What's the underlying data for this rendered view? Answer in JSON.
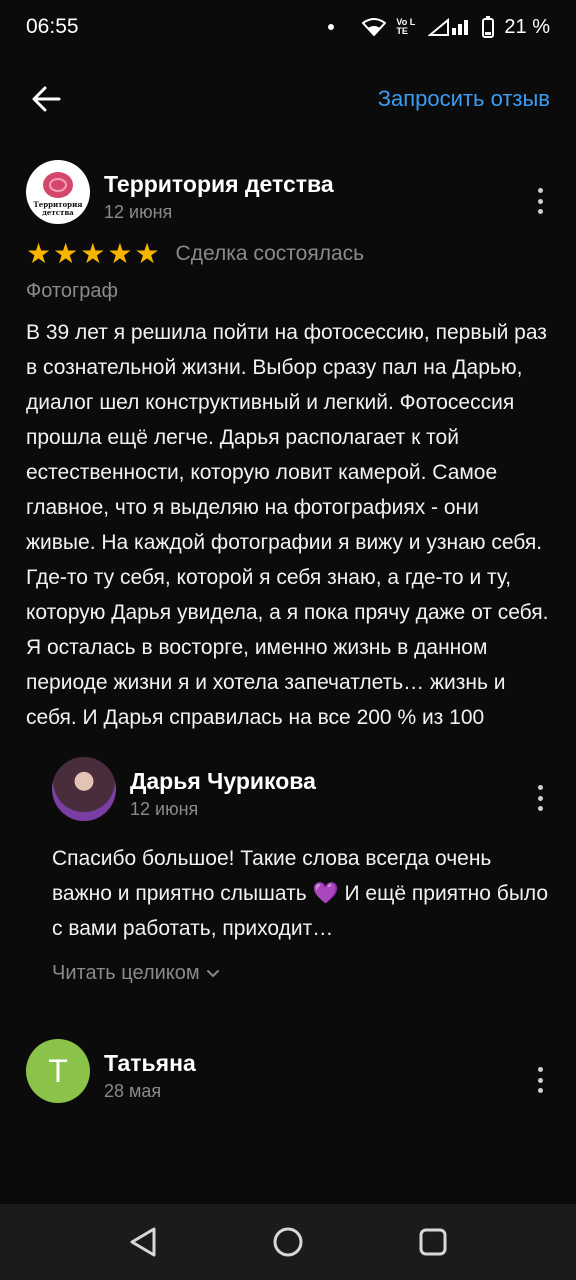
{
  "status_bar": {
    "time": "06:55",
    "network_label": "Vo LTE",
    "battery": "21 %"
  },
  "app_bar": {
    "back_icon": "arrow-left-icon",
    "request_label": "Запросить отзыв",
    "accent_color": "#3a9cf2"
  },
  "review": {
    "author": "Территория детства",
    "logo_text": "Территория детства",
    "date": "12 июня",
    "rating": 5,
    "rating_max": 5,
    "deal_status": "Сделка состоялась",
    "category": "Фотограф",
    "text": "В 39 лет я решила пойти на фотосессию, первый раз в сознательной жизни. Выбор сразу пал на Дарью, диалог шел конструктивный и легкий. Фотосессия прошла ещё легче. Дарья располагает к той естественности, которую ловит камерой. Самое главное, что я выделяю на фотографиях - они живые. На каждой фотографии я вижу и узнаю себя. Где-то ту себя, которой я себя знаю, а где-то и ту, которую Дарья увидела, а я пока прячу даже от себя. Я осталась в восторге, именно жизнь в данном периоде жизни я и хотела запечатлеть… жизнь и себя. И Дарья справилась на все 200 % из 100",
    "star_color": "#f7b500"
  },
  "reply": {
    "author": "Дарья Чурикова",
    "date": "12 июня",
    "text_before": "Спасибо большое! Такие слова всегда очень важно и приятно слышать ",
    "emoji": "💜",
    "text_after": " И ещё приятно было с вами работать, приходит…",
    "read_more": "Читать целиком"
  },
  "review2": {
    "author": "Татьяна",
    "avatar_letter": "Т",
    "date": "28 мая",
    "avatar_color": "#8bc34a"
  },
  "nav_bar": {
    "back": "triangle-back-icon",
    "home": "circle-home-icon",
    "recents": "square-recents-icon"
  }
}
